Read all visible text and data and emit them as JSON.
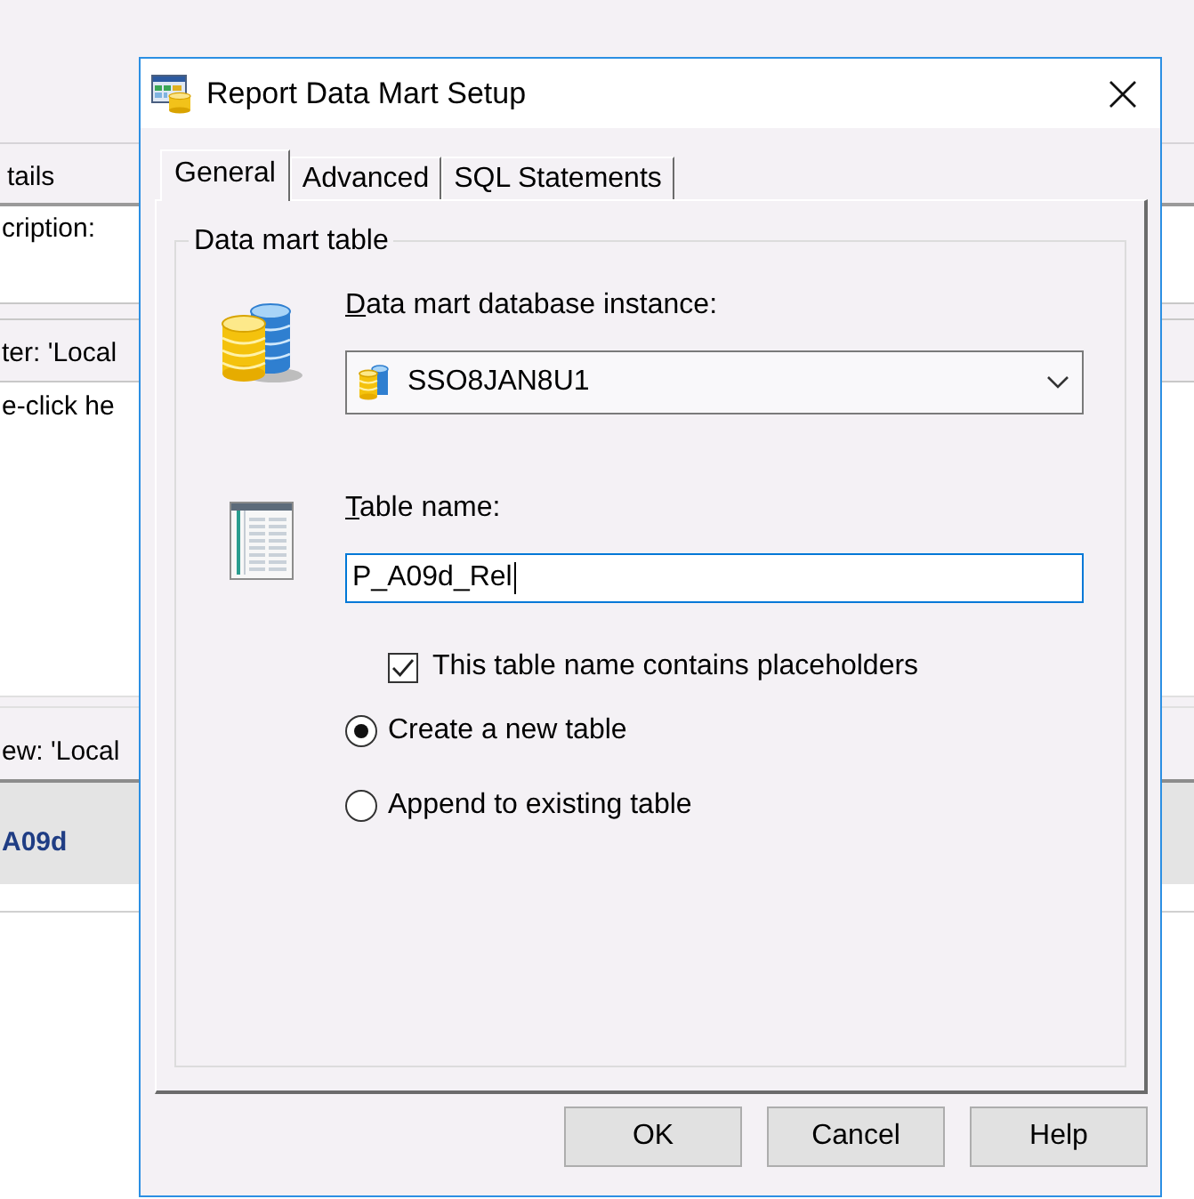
{
  "background_window": {
    "header_tab": "tails",
    "description_label": "cription:",
    "filter_label": "ter: 'Local",
    "hint_text": "e-click he",
    "view_label": "ew: 'Local",
    "row_cell": "A09d"
  },
  "dialog": {
    "title": "Report Data Mart Setup"
  },
  "tabs": [
    {
      "label": "General",
      "selected": true
    },
    {
      "label": "Advanced",
      "selected": false
    },
    {
      "label": "SQL Statements",
      "selected": false
    }
  ],
  "group": {
    "legend": "Data mart table"
  },
  "instance_field": {
    "label": "Data mart database instance:",
    "value": "SSO8JAN8U1"
  },
  "table_name_field": {
    "label": "Table name:",
    "value": "P_A09d_Rel",
    "focused": true
  },
  "placeholders_checkbox": {
    "label": "This table name contains placeholders",
    "checked": true
  },
  "table_mode_options": [
    {
      "label": "Create a new table",
      "selected": true
    },
    {
      "label": "Append to existing table",
      "selected": false
    }
  ],
  "buttons": [
    "OK",
    "Cancel",
    "Help"
  ]
}
